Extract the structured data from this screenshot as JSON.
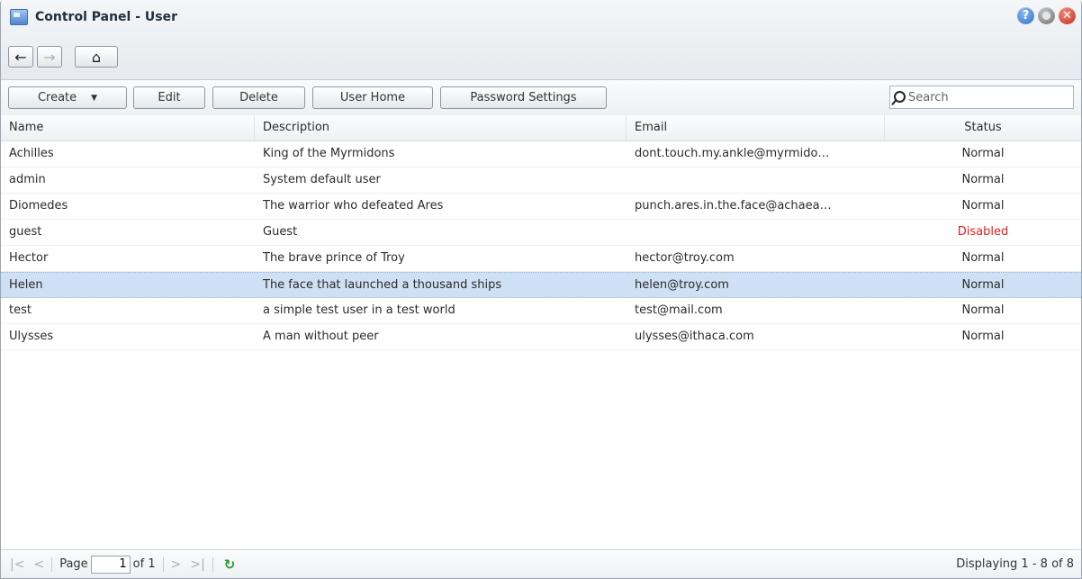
{
  "window": {
    "title": "Control Panel - User",
    "controls": {
      "help": "?",
      "close": "✕"
    }
  },
  "nav": {
    "back": "←",
    "forward": "→",
    "home": "⌂"
  },
  "toolbar": {
    "create": "Create",
    "edit": "Edit",
    "delete": "Delete",
    "user_home": "User Home",
    "password_settings": "Password Settings",
    "search_placeholder": "Search"
  },
  "columns": [
    "Name",
    "Description",
    "Email",
    "Status"
  ],
  "users": [
    {
      "name": "Achilles",
      "description": "King of the Myrmidons",
      "email": "dont.touch.my.ankle@myrmido…",
      "status": "Normal"
    },
    {
      "name": "admin",
      "description": "System default user",
      "email": "",
      "status": "Normal"
    },
    {
      "name": "Diomedes",
      "description": "The warrior who defeated Ares",
      "email": "punch.ares.in.the.face@achaea…",
      "status": "Normal"
    },
    {
      "name": "guest",
      "description": "Guest",
      "email": "",
      "status": "Disabled"
    },
    {
      "name": "Hector",
      "description": "The brave prince of Troy",
      "email": "hector@troy.com",
      "status": "Normal"
    },
    {
      "name": "Helen",
      "description": "The face that launched a thousand ships",
      "email": "helen@troy.com",
      "status": "Normal"
    },
    {
      "name": "test",
      "description": "a simple test user in a test world",
      "email": "test@mail.com",
      "status": "Normal"
    },
    {
      "name": "Ulysses",
      "description": "A man without peer",
      "email": "ulysses@ithaca.com",
      "status": "Normal"
    }
  ],
  "selected_user": "Helen",
  "pager": {
    "page_label": "Page",
    "page_value": "1",
    "of_label": "of 1",
    "display_info": "Displaying 1 - 8 of 8"
  },
  "colors": {
    "selected_row": "#cfe0f4",
    "disabled_status": "#e02020",
    "refresh": "#2c9b2c"
  }
}
